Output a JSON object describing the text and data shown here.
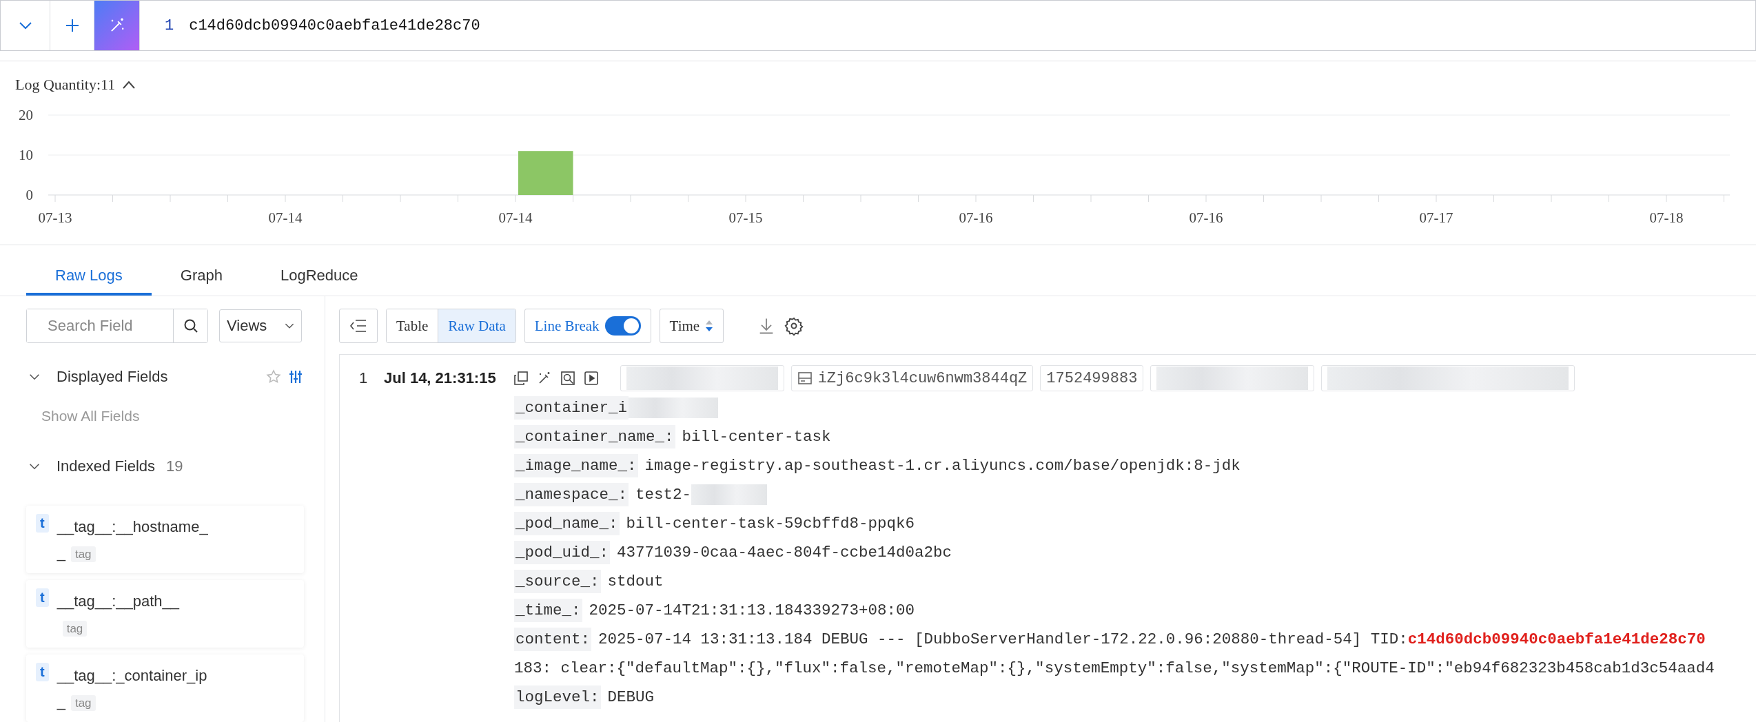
{
  "query_bar": {
    "line_number": "1",
    "query": "c14d60dcb09940c0aebfa1e41de28c70"
  },
  "histogram": {
    "title": "Log Quantity:11",
    "expanded": true,
    "chart_data": {
      "type": "bar",
      "categories": [
        "07-13",
        "07-14",
        "07-14",
        "07-15",
        "07-16",
        "07-16",
        "07-17",
        "07-18"
      ],
      "ylim": [
        0,
        20
      ],
      "yticks": [
        0,
        10,
        20
      ],
      "series": [
        {
          "color": "#8cc665",
          "values": [
            0,
            0,
            11,
            0,
            0,
            0,
            0,
            0
          ]
        }
      ]
    }
  },
  "tabs": [
    {
      "label": "Raw Logs",
      "selected": true
    },
    {
      "label": "Graph",
      "selected": false
    },
    {
      "label": "LogReduce",
      "selected": false
    }
  ],
  "sidebar": {
    "search": {
      "placeholder": "Search Field"
    },
    "views": "Views",
    "displayed_fields": {
      "title": "Displayed Fields",
      "expanded": true,
      "link": "Show All Fields"
    },
    "indexed_fields": {
      "title": "Indexed Fields",
      "count": "19",
      "expanded": true,
      "fields": [
        {
          "type": "t",
          "name": "__tag__:__hostname__",
          "tag": "tag"
        },
        {
          "type": "t",
          "name": "__tag__:__path__",
          "tag": "tag"
        },
        {
          "type": "t",
          "name": "__tag__:_container_ip_",
          "tag": "tag"
        }
      ]
    }
  },
  "toolbar": {
    "view_modes": [
      {
        "label": "Table",
        "selected": false
      },
      {
        "label": "Raw Data",
        "selected": true
      }
    ],
    "line_break": {
      "label": "Line Break",
      "on": true
    },
    "sort": {
      "label": "Time"
    }
  },
  "logs": [
    {
      "index": "1",
      "time": "Jul 14, 21:31:15",
      "chips": [
        {
          "kind": "redacted"
        },
        {
          "kind": "host",
          "text": "iZj6c9k3l4cuw6nwm3844qZ"
        },
        {
          "kind": "plain",
          "text": "1752499883"
        },
        {
          "kind": "redacted"
        },
        {
          "kind": "redacted"
        }
      ],
      "fields": [
        {
          "key": "_container_i",
          "redacted": true
        },
        {
          "key": "_container_name_:",
          "value": "bill-center-task"
        },
        {
          "key": "_image_name_:",
          "value": "image-registry.ap-southeast-1.cr.aliyuncs.com/base/openjdk:8-jdk"
        },
        {
          "key": "_namespace_:",
          "value": "test2-",
          "redacted": true
        },
        {
          "key": "_pod_name_:",
          "value": "bill-center-task-59cbffd8-ppqk6"
        },
        {
          "key": "_pod_uid_:",
          "value": "43771039-0caa-4aec-804f-ccbe14d0a2bc"
        },
        {
          "key": "_source_:",
          "value": "stdout"
        },
        {
          "key": "_time_:",
          "value": "2025-07-14T21:31:13.184339273+08:00"
        },
        {
          "key": "content:",
          "value": "2025-07-14 13:31:13.184 DEBUG --- [DubboServerHandler-172.22.0.96:20880-thread-54] TID:",
          "highlight": "c14d60dcb09940c0aebfa1e41de28c70",
          "continuation": "183: clear:{\"defaultMap\":{},\"flux\":false,\"remoteMap\":{},\"systemEmpty\":false,\"systemMap\":{\"ROUTE-ID\":\"eb94f682323b458cab1d3c54aad4"
        },
        {
          "key": "logLevel:",
          "value": "DEBUG"
        }
      ]
    }
  ]
}
